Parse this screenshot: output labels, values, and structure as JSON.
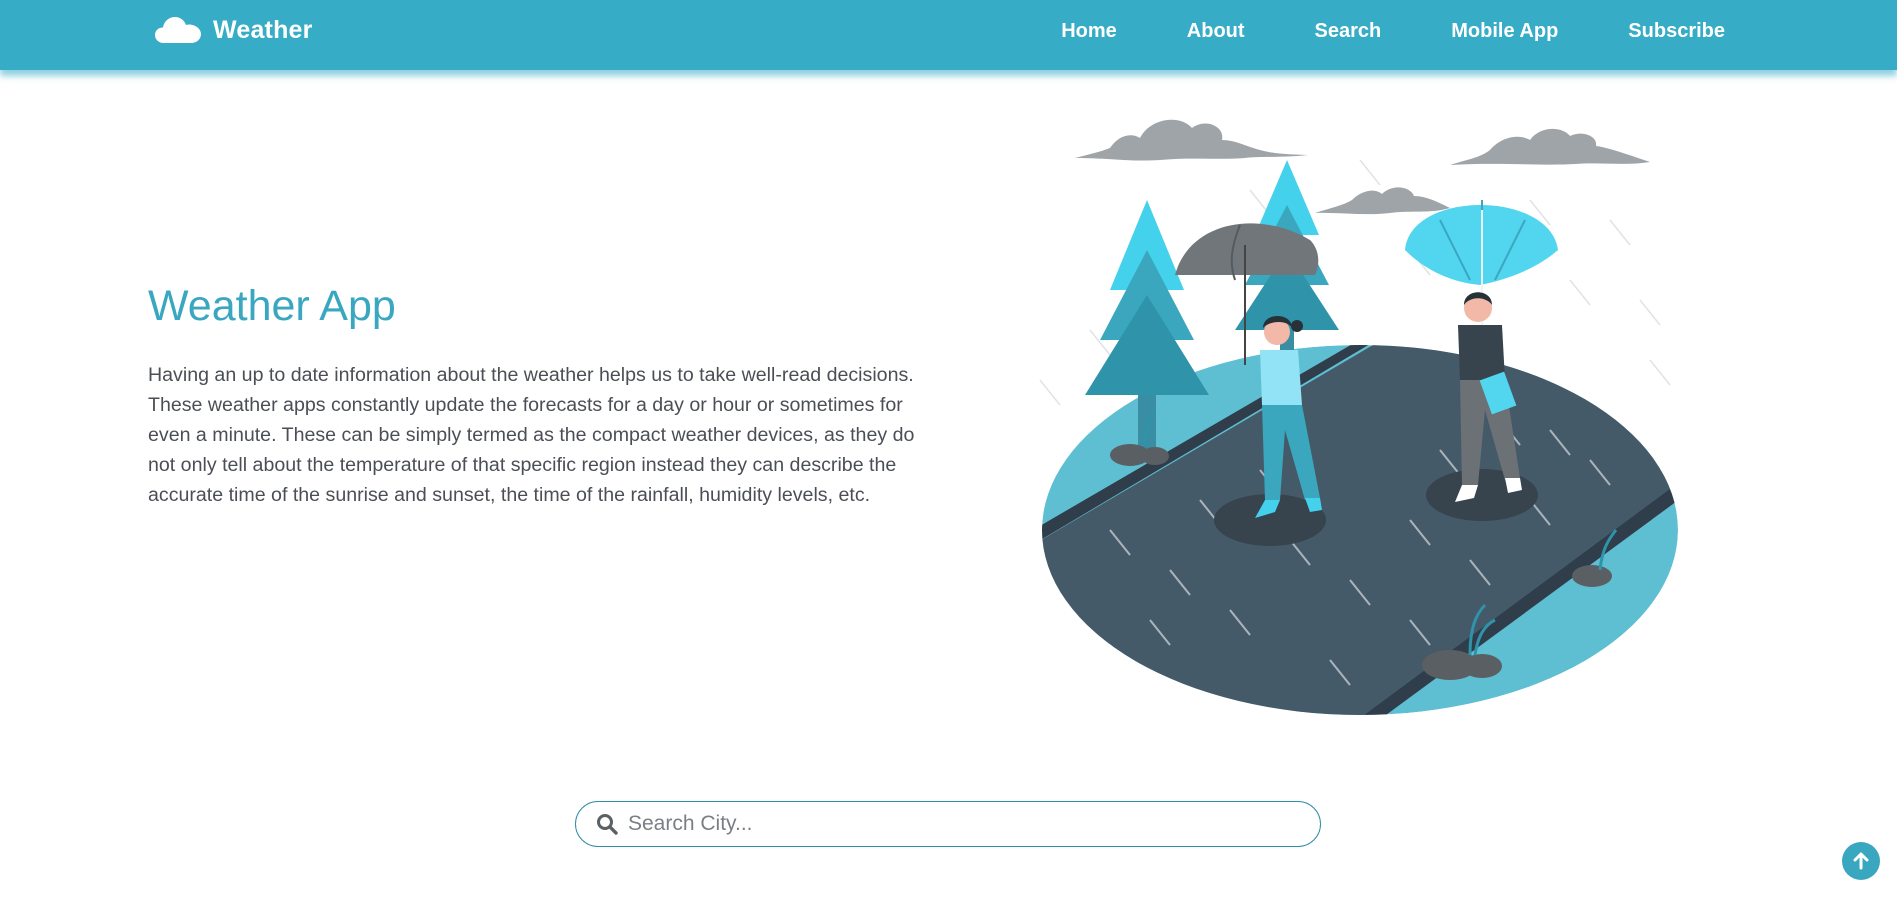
{
  "brand": {
    "name": "Weather",
    "icon": "cloud-icon"
  },
  "nav": {
    "links": [
      {
        "label": "Home"
      },
      {
        "label": "About"
      },
      {
        "label": "Search"
      },
      {
        "label": "Mobile App"
      },
      {
        "label": "Subscribe"
      }
    ]
  },
  "hero": {
    "title": "Weather App",
    "description": "Having an up to date information about the weather helps us to take well-read decisions. These weather apps constantly update the forecasts for a day or hour or sometimes for even a minute. These can be simply termed as the compact weather devices, as they do not only tell about the temperature of that specific region instead they can describe the accurate time of the sunrise and sunset, the time of the rainfall, humidity levels, etc.",
    "illustration": "people-walking-in-rain-with-umbrellas"
  },
  "search": {
    "placeholder": "Search City...",
    "value": "",
    "icon": "search-icon"
  },
  "scroll_top": {
    "icon": "arrow-up-icon"
  },
  "colors": {
    "primary": "#37acc6",
    "title": "#3aa7c1",
    "text": "#4b4f55",
    "road": "#455a69",
    "grass": "#5fbfd2",
    "tree": "#3aa7bf",
    "cloud": "#9ea4a8"
  }
}
